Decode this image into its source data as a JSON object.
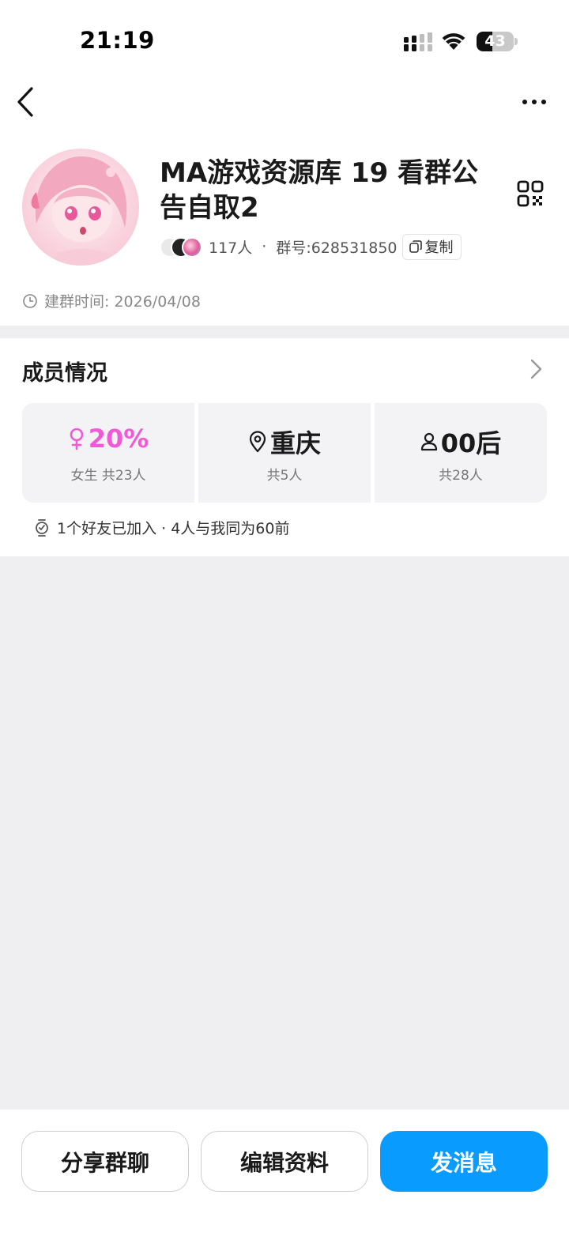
{
  "status_bar": {
    "time": "21:19",
    "battery": "43",
    "battery_level": 0.43
  },
  "group": {
    "name": "MA游戏资源库 19 看群公告自取2",
    "member_count": "117人",
    "separator": "·",
    "group_number": "群号:628531850",
    "copy_label": "复制",
    "created": "建群时间: 2026/04/08"
  },
  "members": {
    "title": "成员情况",
    "stats": [
      {
        "main": "20%",
        "sub": "女生 共23人",
        "icon": "female-icon",
        "color": "#f05ad6"
      },
      {
        "main": "重庆",
        "sub": "共5人",
        "icon": "location-icon"
      },
      {
        "main": "00后",
        "sub": "共28人",
        "icon": "person-icon"
      }
    ],
    "friends_note": "1个好友已加入 · 4人与我同为60前"
  },
  "actions": {
    "share": "分享群聊",
    "edit": "编辑资料",
    "send": "发消息"
  },
  "colors": {
    "accent": "#0a9bff",
    "pink": "#f05ad6"
  }
}
